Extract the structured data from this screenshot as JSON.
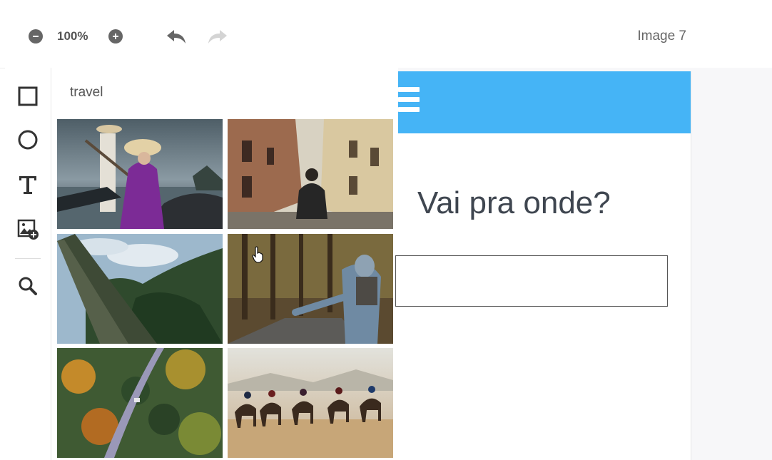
{
  "topbar": {
    "zoom_level": "100%",
    "image_title": "Image 7",
    "icons": {
      "zoom_out": "minus-circle-icon",
      "zoom_in": "plus-circle-icon",
      "undo": "undo-icon",
      "redo": "redo-icon"
    }
  },
  "toolbar": {
    "tools": [
      "rectangle-icon",
      "circle-icon",
      "text-icon",
      "add-image-icon",
      "search-icon"
    ]
  },
  "side_panel": {
    "search_query": "travel",
    "photos": [
      "boat-woman-photo",
      "alley-man-photo",
      "forest-photo",
      "hitchhiker-photo",
      "forest-road-photo",
      "camels-desert-photo"
    ]
  },
  "canvas": {
    "header_color": "#45b4f6",
    "headline": "Vai pra onde?",
    "input_value": "",
    "input_placeholder": ""
  }
}
